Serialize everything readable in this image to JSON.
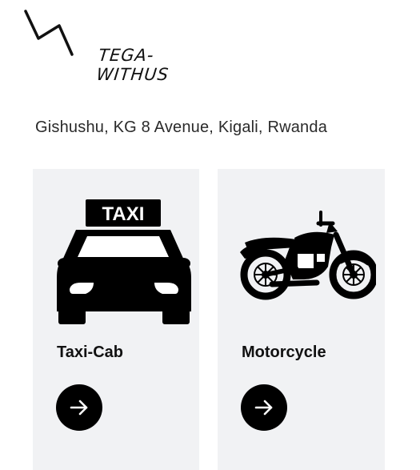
{
  "brand": {
    "logo_text": "TEGA-WITHUS"
  },
  "location": {
    "address": "Gishushu, KG 8 Avenue, Kigali, Rwanda"
  },
  "vehicles": [
    {
      "title": "Taxi-Cab",
      "sign_text": "TAXI",
      "icon": "taxi-icon",
      "action_icon": "arrow-right-icon"
    },
    {
      "title": "Motorcycle",
      "icon": "motorcycle-icon",
      "action_icon": "arrow-right-icon"
    }
  ],
  "colors": {
    "card_background": "#f1f2f4",
    "icon": "#000000",
    "text": "#111111"
  }
}
